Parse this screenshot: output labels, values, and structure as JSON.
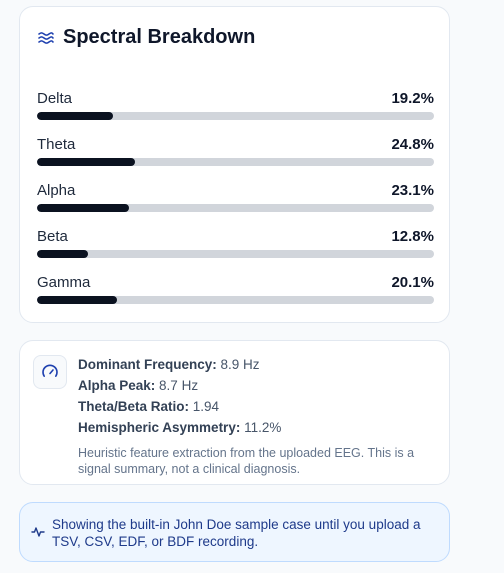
{
  "spectral": {
    "title": "Spectral Breakdown",
    "bands": [
      {
        "name": "Delta",
        "value_label": "19.2%",
        "level": 0.192
      },
      {
        "name": "Theta",
        "value_label": "24.8%",
        "level": 0.248
      },
      {
        "name": "Alpha",
        "value_label": "23.1%",
        "level": 0.231
      },
      {
        "name": "Beta",
        "value_label": "12.8%",
        "level": 0.128
      },
      {
        "name": "Gamma",
        "value_label": "20.1%",
        "level": 0.201
      }
    ],
    "icon": "waves-icon"
  },
  "metrics": {
    "icon": "gauge-icon",
    "dominant_frequency_label": "Dominant Frequency:",
    "dominant_frequency_value": "8.9 Hz",
    "alpha_peak_label": "Alpha Peak:",
    "alpha_peak_value": "8.7 Hz",
    "theta_beta_label": "Theta/Beta Ratio:",
    "theta_beta_value": "1.94",
    "asymmetry_label": "Hemispheric Asymmetry:",
    "asymmetry_value": "11.2%",
    "note": "Heuristic feature extraction from the uploaded EEG. This is a signal summary, not a clinical diagnosis."
  },
  "notice": {
    "icon": "activity-icon",
    "text": "Showing the built-in John Doe sample case until you upload a TSV, CSV, EDF, or BDF recording."
  },
  "colors": {
    "bar_fill": "#0b1220",
    "bar_track": "#d1d5db",
    "accent": "#1e40af",
    "notice_bg": "#eef6ff"
  }
}
